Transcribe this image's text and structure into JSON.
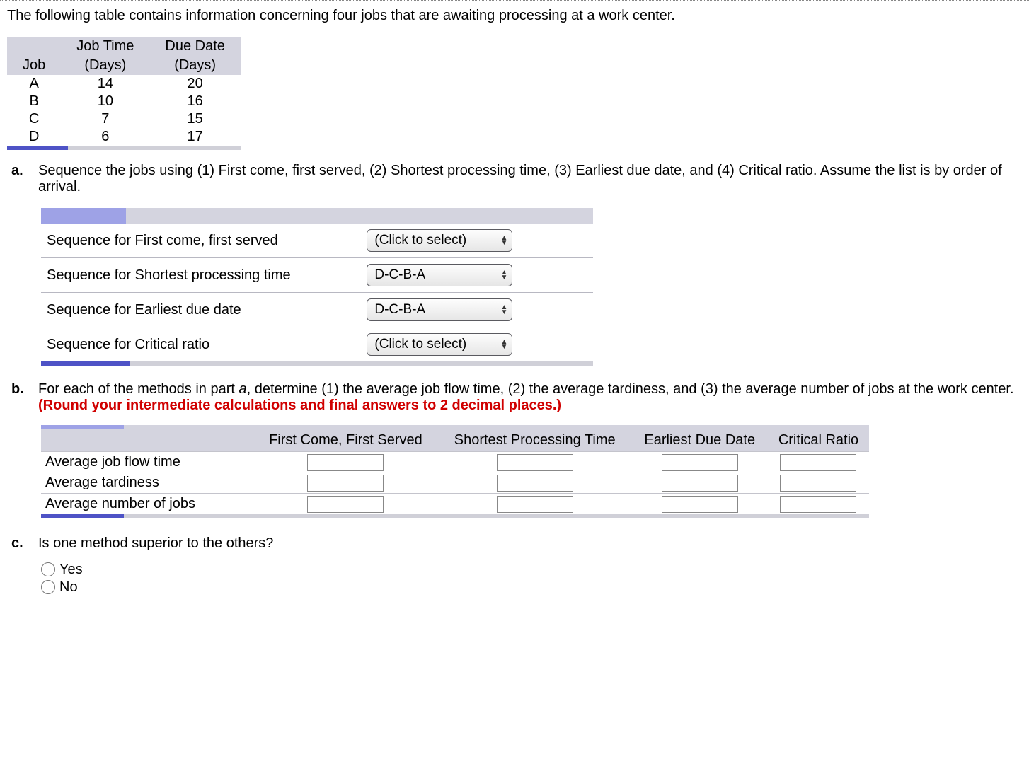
{
  "intro": "The following table contains information concerning four jobs that are awaiting processing at a work center.",
  "job_table": {
    "headers": {
      "job": "Job",
      "time": "Job Time (Days)",
      "due": "Due Date (Days)"
    },
    "header_top": {
      "time": "Job Time",
      "due": "Due Date"
    },
    "header_bot": {
      "job": "Job",
      "time": "(Days)",
      "due": "(Days)"
    },
    "rows": [
      {
        "job": "A",
        "time": "14",
        "due": "20"
      },
      {
        "job": "B",
        "time": "10",
        "due": "16"
      },
      {
        "job": "C",
        "time": "7",
        "due": "15"
      },
      {
        "job": "D",
        "time": "6",
        "due": "17"
      }
    ]
  },
  "part_a": {
    "marker": "a.",
    "text": "Sequence the jobs using (1) First come, first served, (2) Shortest processing time, (3) Earliest due date, and (4) Critical ratio. Assume the list is by order of arrival.",
    "rows": [
      {
        "label": "Sequence for First come, first served",
        "value": "(Click to select)"
      },
      {
        "label": "Sequence for Shortest processing time",
        "value": "D-C-B-A"
      },
      {
        "label": "Sequence for Earliest due date",
        "value": "D-C-B-A"
      },
      {
        "label": "Sequence for Critical ratio",
        "value": "(Click to select)"
      }
    ]
  },
  "part_b": {
    "marker": "b.",
    "text_lead": "For each of the methods in part ",
    "text_ital": "a",
    "text_mid": ", determine (1) the average job flow time, (2) the average tardiness, and (3) the average number of jobs at the work center. ",
    "text_red": "(Round your intermediate calculations and final answers to 2 decimal places.)",
    "col_headers": [
      "First Come, First Served",
      "Shortest Processing Time",
      "Earliest Due Date",
      "Critical Ratio"
    ],
    "row_labels": [
      "Average job flow time",
      "Average tardiness",
      "Average number of jobs"
    ]
  },
  "part_c": {
    "marker": "c.",
    "text": "Is one method superior to the others?",
    "options": [
      "Yes",
      "No"
    ]
  },
  "chart_data": {
    "type": "table",
    "title": "Job processing data",
    "columns": [
      "Job",
      "Job Time (Days)",
      "Due Date (Days)"
    ],
    "rows": [
      [
        "A",
        14,
        20
      ],
      [
        "B",
        10,
        16
      ],
      [
        "C",
        7,
        15
      ],
      [
        "D",
        6,
        17
      ]
    ]
  }
}
